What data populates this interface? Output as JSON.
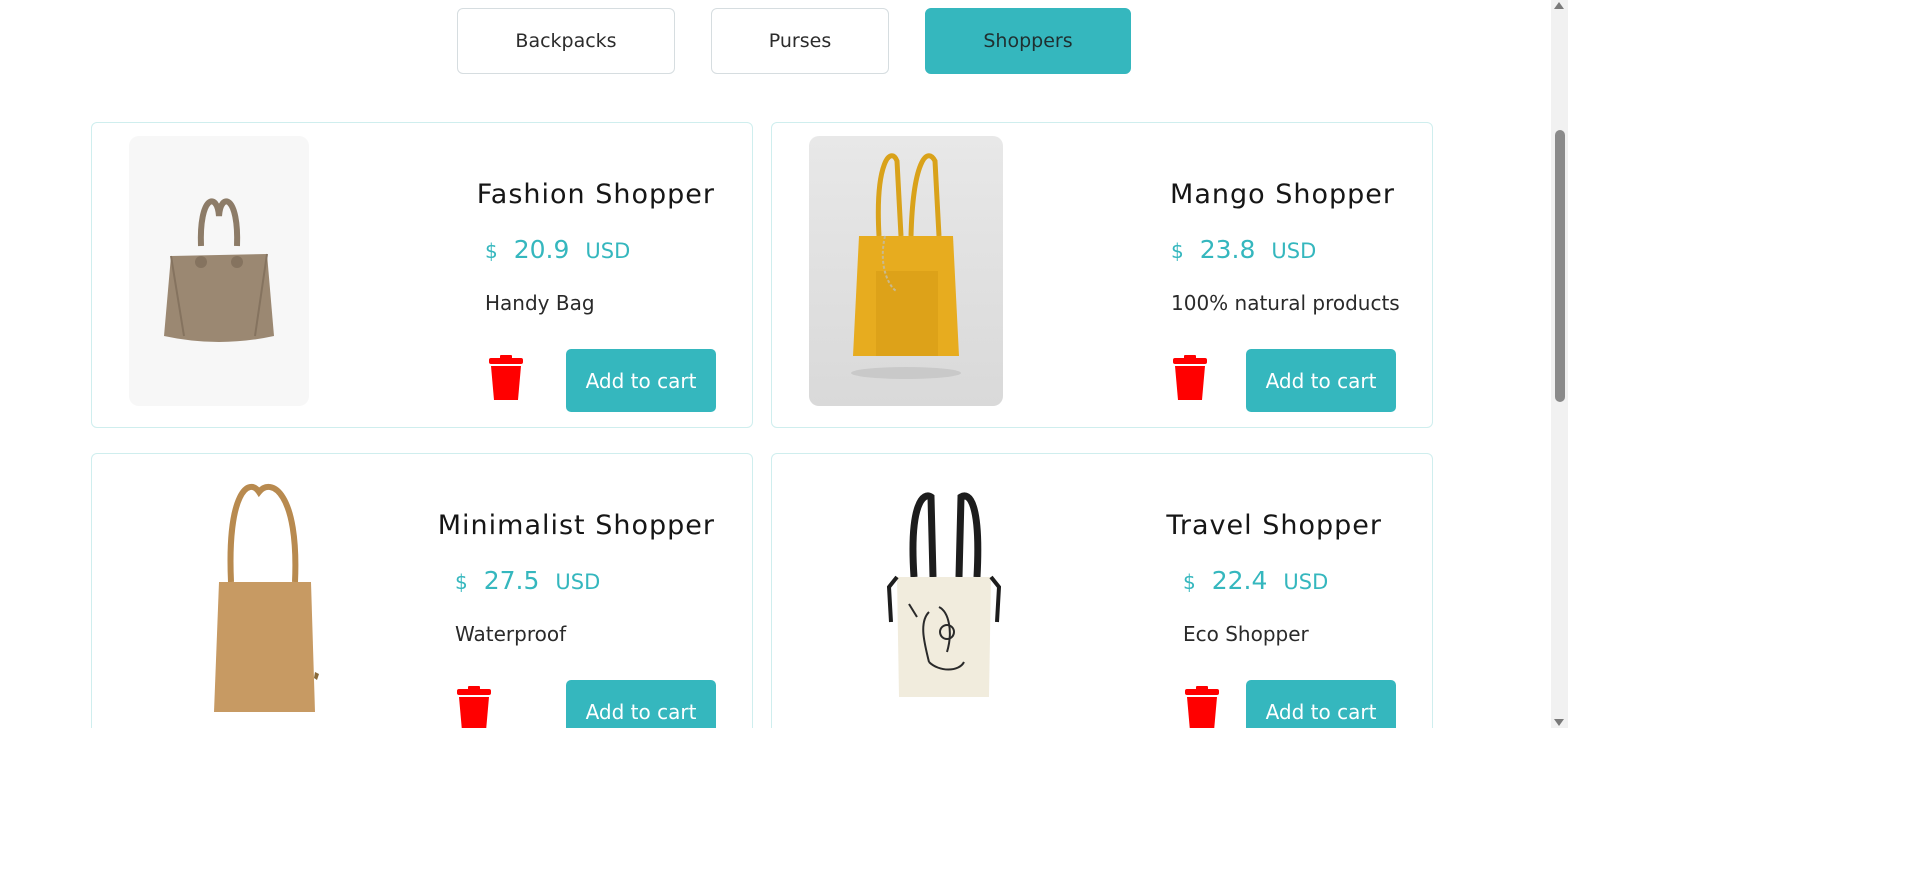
{
  "tabs": {
    "backpacks": "Backpacks",
    "purses": "Purses",
    "shoppers": "Shoppers",
    "active": "Shoppers"
  },
  "products": [
    {
      "name": "Fashion Shopper",
      "currency_symbol": "$",
      "price": "20.9",
      "currency": "USD",
      "description": "Handy Bag",
      "button": "Add to cart"
    },
    {
      "name": "Mango Shopper",
      "currency_symbol": "$",
      "price": "23.8",
      "currency": "USD",
      "description": "100% natural products",
      "button": "Add to cart"
    },
    {
      "name": "Minimalist Shopper",
      "currency_symbol": "$",
      "price": "27.5",
      "currency": "USD",
      "description": "Waterproof",
      "button": "Add to cart"
    },
    {
      "name": "Travel Shopper",
      "currency_symbol": "$",
      "price": "22.4",
      "currency": "USD",
      "description": "Eco Shopper",
      "button": "Add to cart"
    }
  ],
  "colors": {
    "accent": "#35b7be",
    "delete": "#ff0000",
    "card_border": "#cfeeee"
  },
  "icons": {
    "delete": "trash-icon"
  }
}
